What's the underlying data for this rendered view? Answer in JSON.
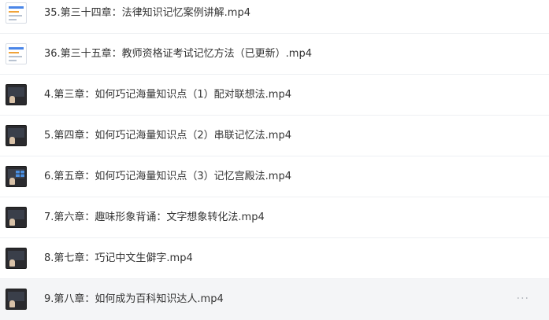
{
  "files": [
    {
      "name": "35.第三十四章：法律知识记忆案例讲解.mp4",
      "thumb": "doc-thumbnail"
    },
    {
      "name": "36.第三十五章：教师资格证考试记忆方法（已更新）.mp4",
      "thumb": "doc-thumbnail"
    },
    {
      "name": "4.第三章：如何巧记海量知识点（1）配对联想法.mp4",
      "thumb": "video-thumbnail"
    },
    {
      "name": "5.第四章：如何巧记海量知识点（2）串联记忆法.mp4",
      "thumb": "video-thumbnail"
    },
    {
      "name": "6.第五章：如何巧记海量知识点（3）记忆宫殿法.mp4",
      "thumb": "video-thumbnail-grid"
    },
    {
      "name": "7.第六章：趣味形象背诵：文字想象转化法.mp4",
      "thumb": "video-thumbnail"
    },
    {
      "name": "8.第七章：巧记中文生僻字.mp4",
      "thumb": "video-thumbnail"
    },
    {
      "name": "9.第八章：如何成为百科知识达人.mp4",
      "thumb": "video-thumbnail"
    }
  ],
  "more_label": "···",
  "colors": {
    "row_hover": "#f4f5f7",
    "text": "#333333",
    "divider": "#eef0f3"
  }
}
